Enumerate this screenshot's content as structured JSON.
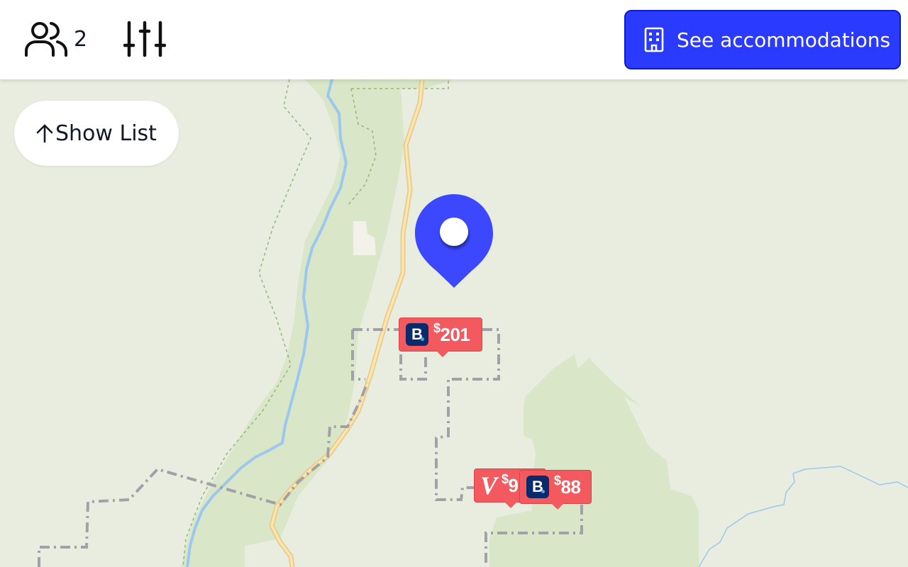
{
  "header": {
    "guests_icon": "users-icon",
    "guests_count": "2",
    "filters_icon": "sliders-icon",
    "accommodations_label": "See accommodations",
    "accommodations_icon": "building-icon",
    "accent_color": "#2b3aff"
  },
  "show_list": {
    "label": "Show List",
    "icon": "arrow-up-icon"
  },
  "map": {
    "location_pin_icon": "location-pin-icon",
    "pin_color": "#3b48ff",
    "marker_color": "#f25a5f",
    "markers": [
      {
        "provider": "Booking.com",
        "logo": "B",
        "currency": "$",
        "price": "201"
      },
      {
        "provider": "Vrbo",
        "logo": "V",
        "currency": "$",
        "price": "9"
      },
      {
        "provider": "Booking.com",
        "logo": "B",
        "currency": "$",
        "price": "88"
      }
    ]
  }
}
